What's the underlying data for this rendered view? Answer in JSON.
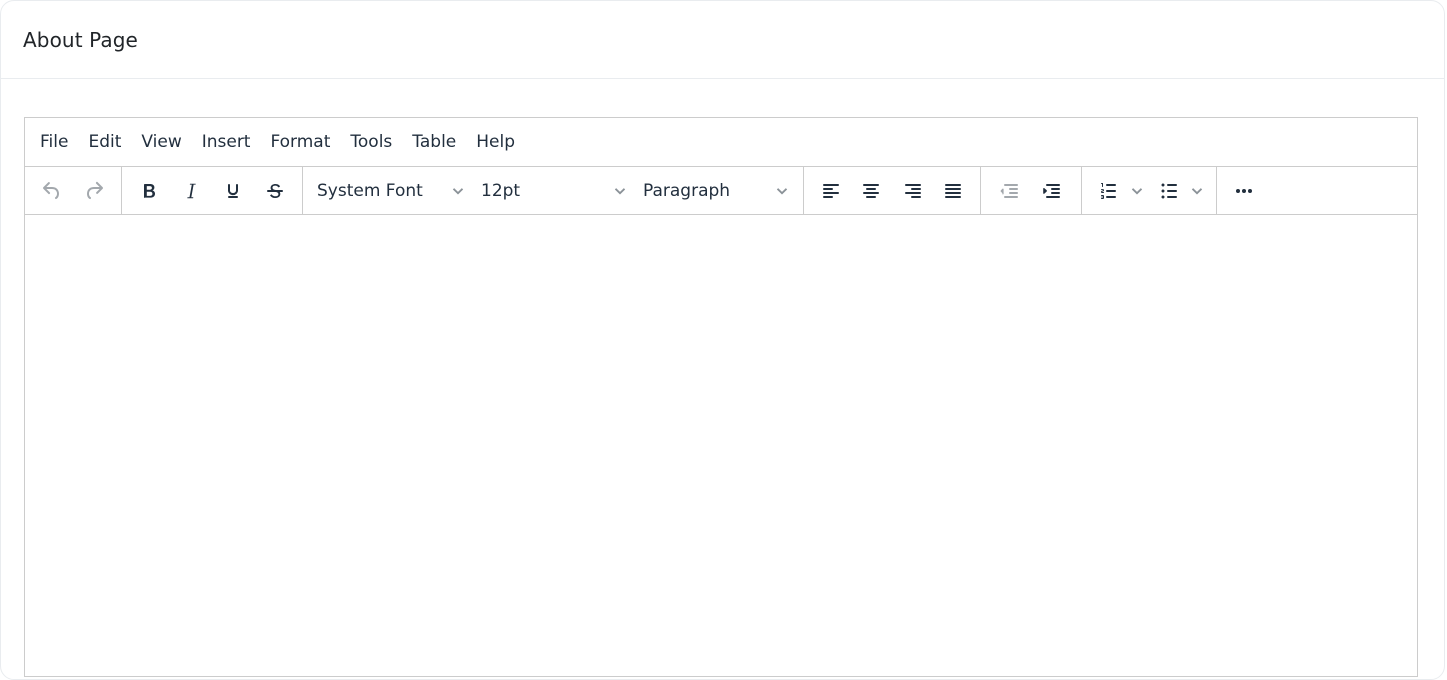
{
  "page": {
    "title": "About Page"
  },
  "editor": {
    "menubar": [
      "File",
      "Edit",
      "View",
      "Insert",
      "Format",
      "Tools",
      "Table",
      "Help"
    ],
    "toolbar": {
      "font_family": "System Font",
      "font_size": "12pt",
      "block_format": "Paragraph"
    },
    "icons": {
      "undo": "undo-icon",
      "redo": "redo-icon",
      "bold": "bold-icon",
      "italic": "italic-icon",
      "underline": "underline-icon",
      "strikethrough": "strikethrough-icon",
      "align_left": "align-left-icon",
      "align_center": "align-center-icon",
      "align_right": "align-right-icon",
      "align_justify": "align-justify-icon",
      "outdent": "outdent-icon",
      "indent": "indent-icon",
      "numbered_list": "numbered-list-icon",
      "bullet_list": "bullet-list-icon",
      "more": "more-horizontal-icon"
    },
    "colors": {
      "text": "#222f3e",
      "disabled": "#a3a8ad",
      "border": "#cccccc"
    }
  }
}
